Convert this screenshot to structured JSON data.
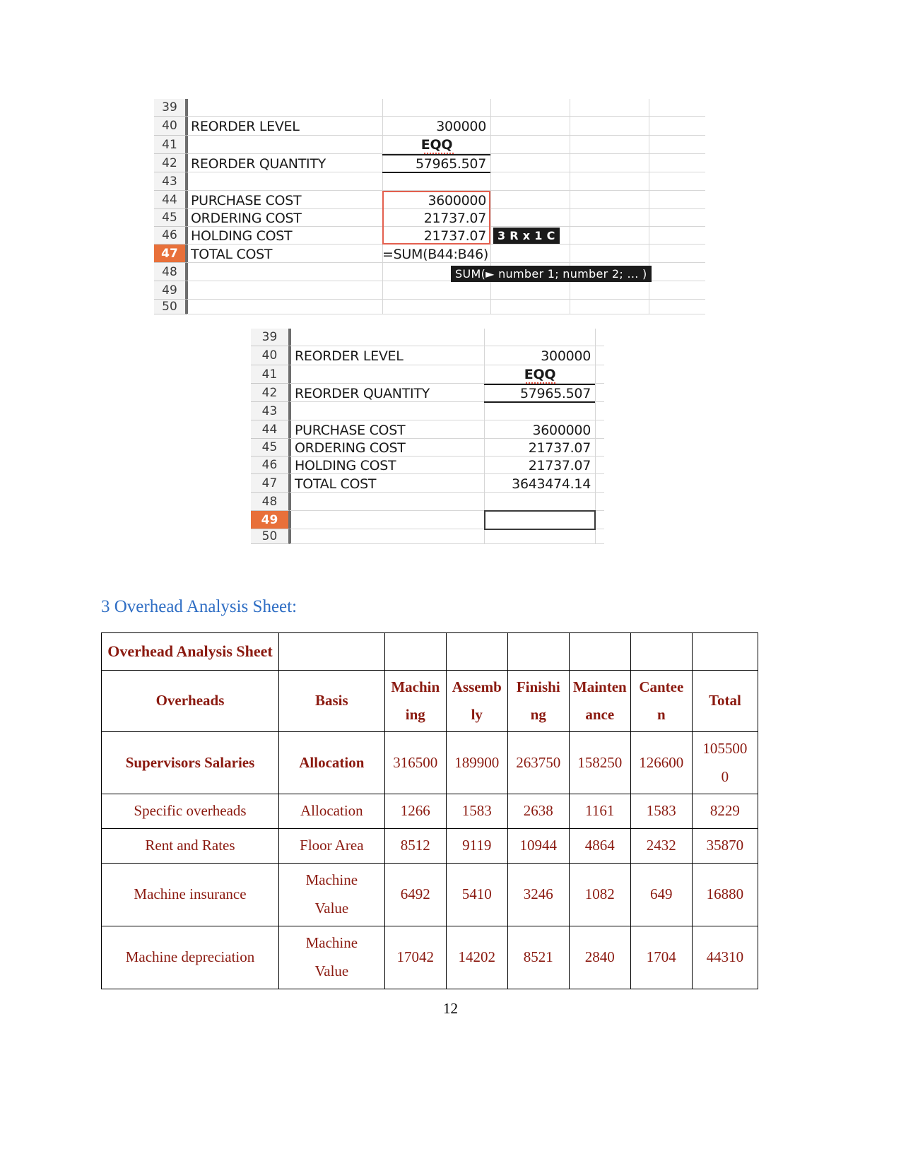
{
  "spreadsheet_top": {
    "row_headers": [
      "39",
      "40",
      "41",
      "42",
      "43",
      "44",
      "45",
      "46",
      "47",
      "48",
      "49",
      "50"
    ],
    "selected_row_header": "47",
    "rows": [
      {
        "label": "",
        "value": ""
      },
      {
        "label": "REORDER LEVEL",
        "value": "300000"
      },
      {
        "label": "",
        "value": "EQQ"
      },
      {
        "label": "REORDER QUANTITY",
        "value": "57965.507"
      },
      {
        "label": "",
        "value": ""
      },
      {
        "label": "PURCHASE COST",
        "value": "3600000"
      },
      {
        "label": "ORDERING COST",
        "value": "21737.07"
      },
      {
        "label": "HOLDING COST",
        "value": "21737.07"
      },
      {
        "label": "TOTAL COST",
        "value": "=SUM(B44:B46)"
      },
      {
        "label": "",
        "value": ""
      },
      {
        "label": "",
        "value": ""
      },
      {
        "label": "",
        "value": ""
      }
    ],
    "range_badge": "3 R x 1 C",
    "formula_tooltip": "SUM(► number 1; number 2; ... )"
  },
  "spreadsheet_bottom": {
    "row_headers": [
      "39",
      "40",
      "41",
      "42",
      "43",
      "44",
      "45",
      "46",
      "47",
      "48",
      "49",
      "50"
    ],
    "selected_row_header": "49",
    "rows": [
      {
        "label": "",
        "value": ""
      },
      {
        "label": "REORDER LEVEL",
        "value": "300000"
      },
      {
        "label": "",
        "value": "EQQ"
      },
      {
        "label": "REORDER QUANTITY",
        "value": "57965.507"
      },
      {
        "label": "",
        "value": ""
      },
      {
        "label": "PURCHASE COST",
        "value": "3600000"
      },
      {
        "label": "ORDERING COST",
        "value": "21737.07"
      },
      {
        "label": "HOLDING COST",
        "value": "21737.07"
      },
      {
        "label": "TOTAL COST",
        "value": "3643474.14"
      },
      {
        "label": "",
        "value": ""
      },
      {
        "label": "",
        "value": ""
      },
      {
        "label": "",
        "value": ""
      }
    ]
  },
  "section": {
    "heading": "3 Overhead Analysis Sheet:"
  },
  "overhead_table": {
    "title": "Overhead Analysis Sheet",
    "dept_headers_line1": [
      "Machin",
      "Assemb",
      "Finishi",
      "Mainten",
      "Cantee"
    ],
    "dept_headers_line2": [
      "ing",
      "ly",
      "ng",
      "ance",
      "n"
    ],
    "col_overheads": "Overheads",
    "col_basis": "Basis",
    "col_total": "Total",
    "rows": [
      {
        "overhead": "Supervisors Salaries",
        "basis": "Allocation",
        "machining": "316500",
        "assembly": "189900",
        "finishing": "263750",
        "maintenance": "158250",
        "canteen": "126600",
        "total_line1": "105500",
        "total_line2": "0",
        "bold": true
      },
      {
        "overhead": "Specific overheads",
        "basis": "Allocation",
        "machining": "1266",
        "assembly": "1583",
        "finishing": "2638",
        "maintenance": "1161",
        "canteen": "1583",
        "total": "8229",
        "bold": false
      },
      {
        "overhead": "Rent and Rates",
        "basis": "Floor Area",
        "machining": "8512",
        "assembly": "9119",
        "finishing": "10944",
        "maintenance": "4864",
        "canteen": "2432",
        "total": "35870",
        "bold": false
      },
      {
        "overhead": "Machine insurance",
        "basis_line1": "Machine",
        "basis_line2": "Value",
        "machining": "6492",
        "assembly": "5410",
        "finishing": "3246",
        "maintenance": "1082",
        "canteen": "649",
        "total": "16880",
        "bold": false
      },
      {
        "overhead": "Machine depreciation",
        "basis_line1": "Machine",
        "basis_line2": "Value",
        "machining": "17042",
        "assembly": "14202",
        "finishing": "8521",
        "maintenance": "2840",
        "canteen": "1704",
        "total": "44310",
        "bold": false
      }
    ]
  },
  "footer": {
    "page_number": "12"
  },
  "colors": {
    "heading_blue": "#2f6ec4",
    "table_text_maroon": "#8b1a10",
    "selection_orange": "#e8703a",
    "selection_red_border": "#e35f4e"
  }
}
